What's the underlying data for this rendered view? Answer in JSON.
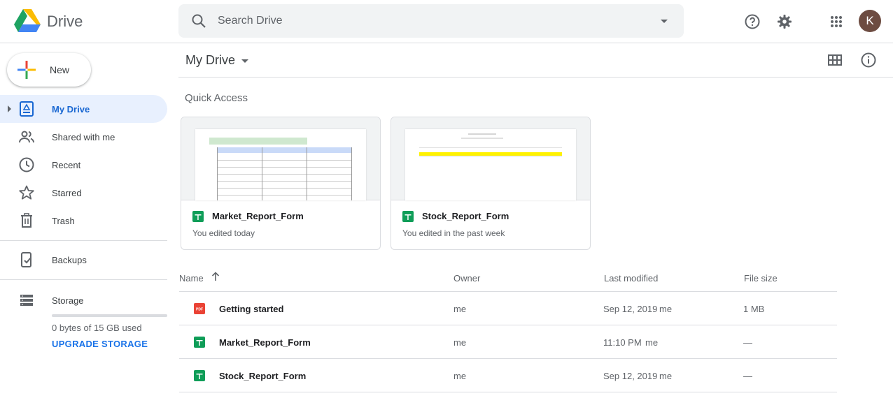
{
  "header": {
    "app_title": "Drive",
    "search_placeholder": "Search Drive",
    "avatar_letter": "K",
    "icons": [
      "drive-logo-icon",
      "search-icon",
      "chevron-down-icon",
      "help-icon",
      "gear-icon",
      "apps-grid-icon"
    ]
  },
  "sidebar": {
    "new_label": "New",
    "items": [
      {
        "label": "My Drive",
        "icon": "my-drive-icon",
        "active": true
      },
      {
        "label": "Shared with me",
        "icon": "people-icon"
      },
      {
        "label": "Recent",
        "icon": "clock-icon"
      },
      {
        "label": "Starred",
        "icon": "star-icon"
      },
      {
        "label": "Trash",
        "icon": "trash-icon"
      },
      {
        "label": "Backups",
        "icon": "backup-device-icon"
      },
      {
        "label": "Storage",
        "icon": "storage-icon"
      }
    ],
    "storage_used": "0 bytes of 15 GB used",
    "upgrade_label": "UPGRADE STORAGE"
  },
  "main": {
    "title": "My Drive",
    "quick_access_title": "Quick Access",
    "quick_access": [
      {
        "name": "Market_Report_Form",
        "subtitle": "You edited today"
      },
      {
        "name": "Stock_Report_Form",
        "subtitle": "You edited in the past week"
      }
    ],
    "columns": {
      "name": "Name",
      "owner": "Owner",
      "modified": "Last modified",
      "size": "File size"
    },
    "files": [
      {
        "name": "Getting started",
        "type": "pdf",
        "owner": "me",
        "modified": "Sep 12, 2019",
        "modified_by": "me",
        "size": "1 MB"
      },
      {
        "name": "Market_Report_Form",
        "type": "sheet",
        "owner": "me",
        "modified": "11:10 PM",
        "modified_by": "me",
        "size": "—"
      },
      {
        "name": "Stock_Report_Form",
        "type": "sheet",
        "owner": "me",
        "modified": "Sep 12, 2019",
        "modified_by": "me",
        "size": "—"
      }
    ]
  },
  "colors": {
    "accent": "#1a73e8",
    "active_bg": "#e8f0fe",
    "sheets_green": "#0f9d58",
    "pdf_red": "#ea4335",
    "avatar_bg": "#6d4c41"
  }
}
